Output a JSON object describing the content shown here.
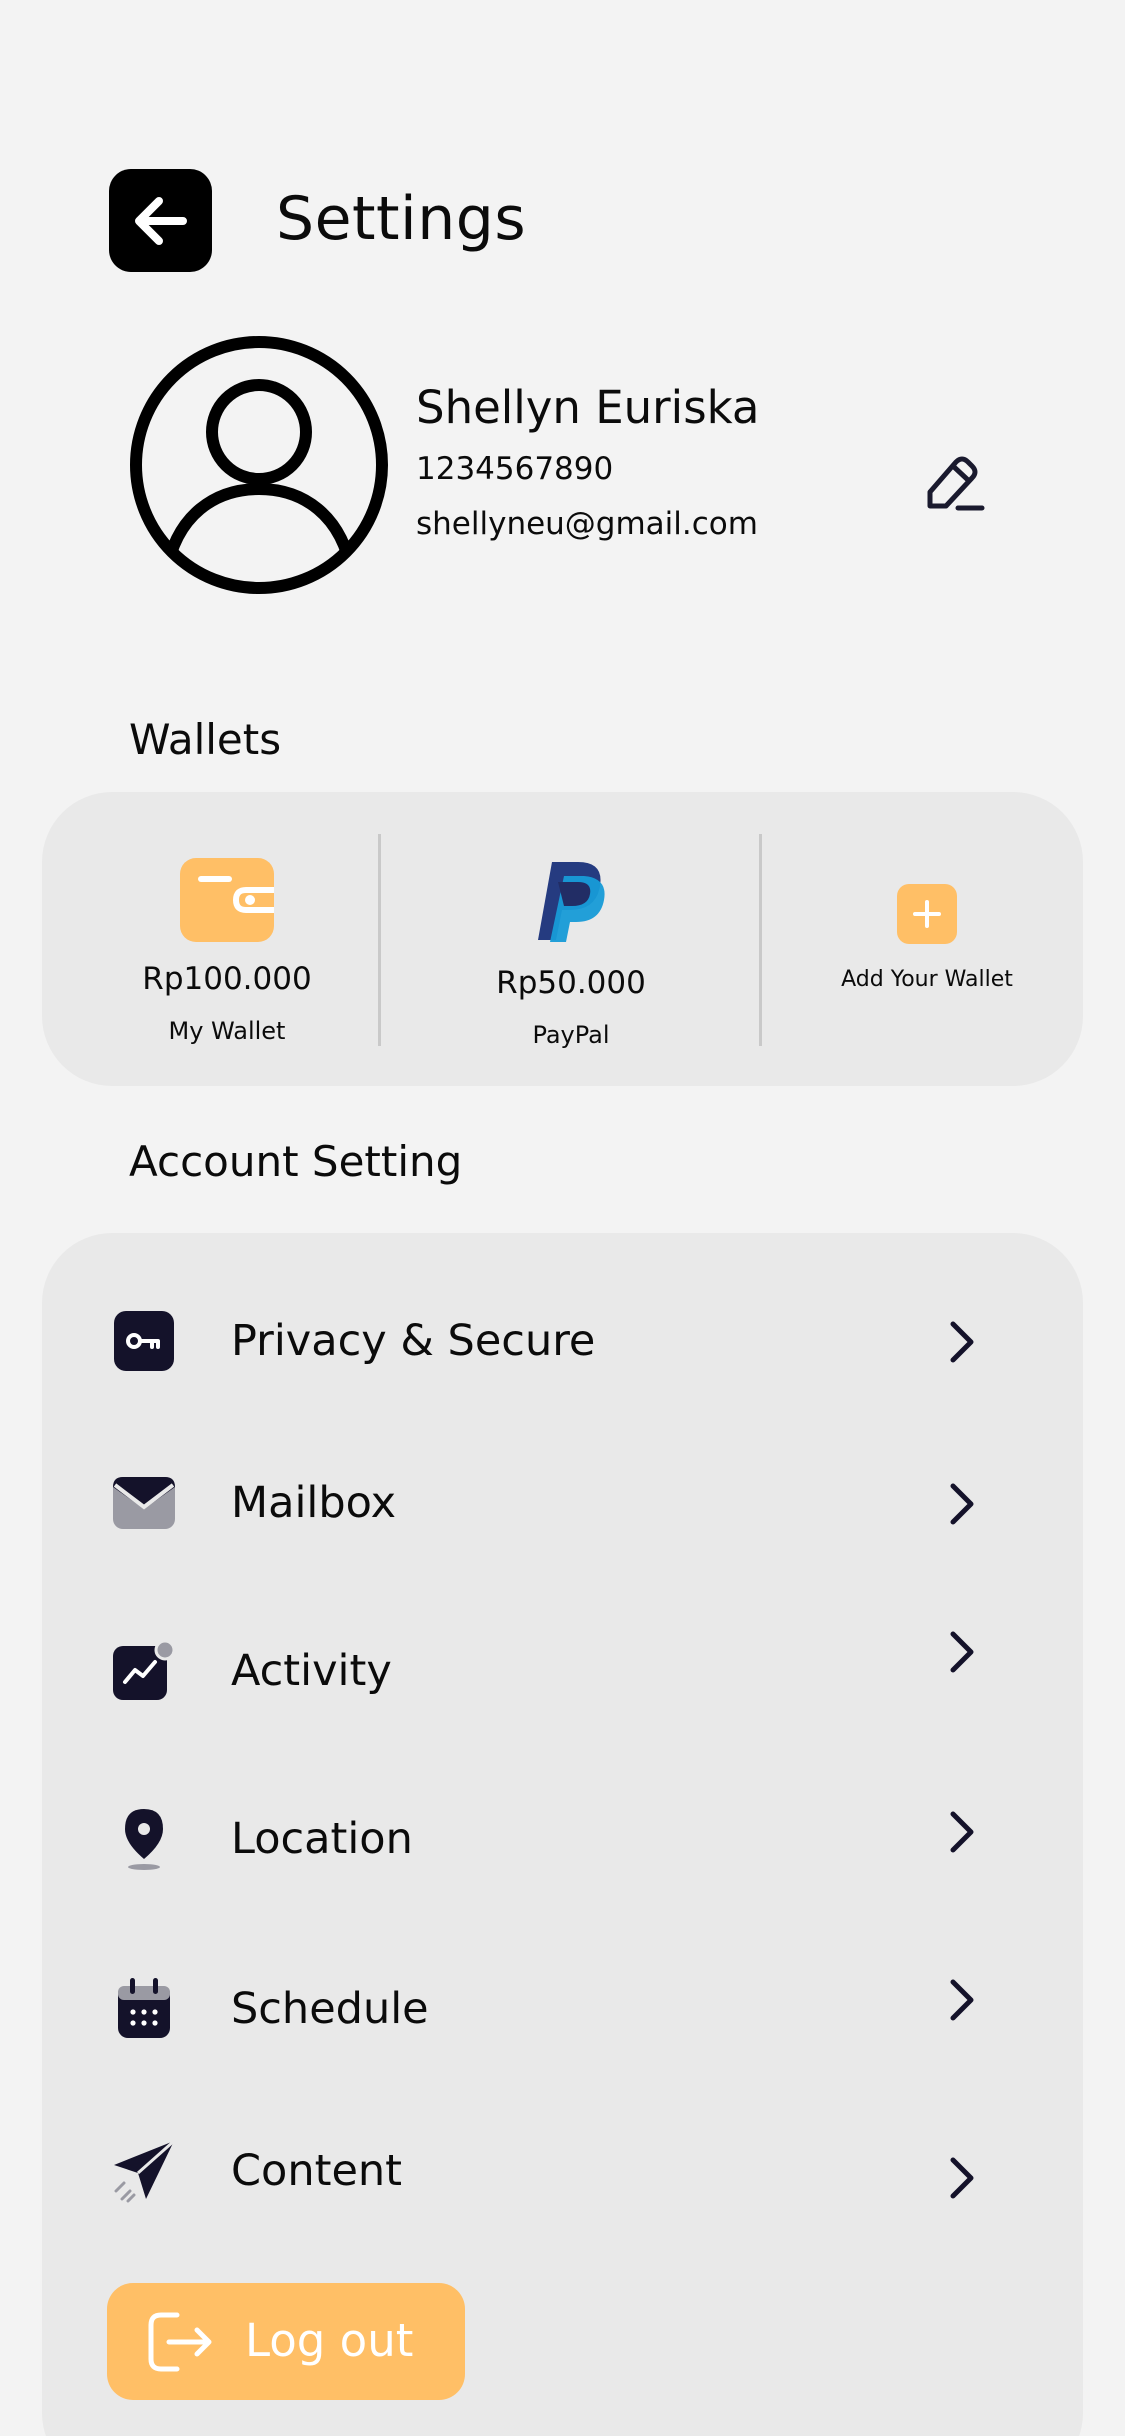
{
  "header": {
    "title": "Settings"
  },
  "profile": {
    "name": "Shellyn Euriska",
    "phone": "1234567890",
    "email": "shellyneu@gmail.com"
  },
  "wallets": {
    "section_title": "Wallets",
    "items": [
      {
        "amount": "Rp100.000",
        "label": "My Wallet",
        "icon": "wallet-icon"
      },
      {
        "amount": "Rp50.000",
        "label": "PayPal",
        "icon": "paypal-icon"
      }
    ],
    "add_label": "Add Your Wallet"
  },
  "account": {
    "section_title": "Account Setting",
    "items": [
      {
        "label": "Privacy & Secure",
        "icon": "key-icon"
      },
      {
        "label": "Mailbox",
        "icon": "mail-icon"
      },
      {
        "label": "Activity",
        "icon": "activity-icon"
      },
      {
        "label": "Location",
        "icon": "location-pin-icon"
      },
      {
        "label": "Schedule",
        "icon": "calendar-icon"
      },
      {
        "label": "Content",
        "icon": "paper-plane-icon"
      }
    ]
  },
  "logout": {
    "label": "Log out"
  },
  "colors": {
    "accent": "#ffbf66",
    "dark": "#14122a",
    "card": "#e9e9e9",
    "background": "#f3f3f3"
  }
}
